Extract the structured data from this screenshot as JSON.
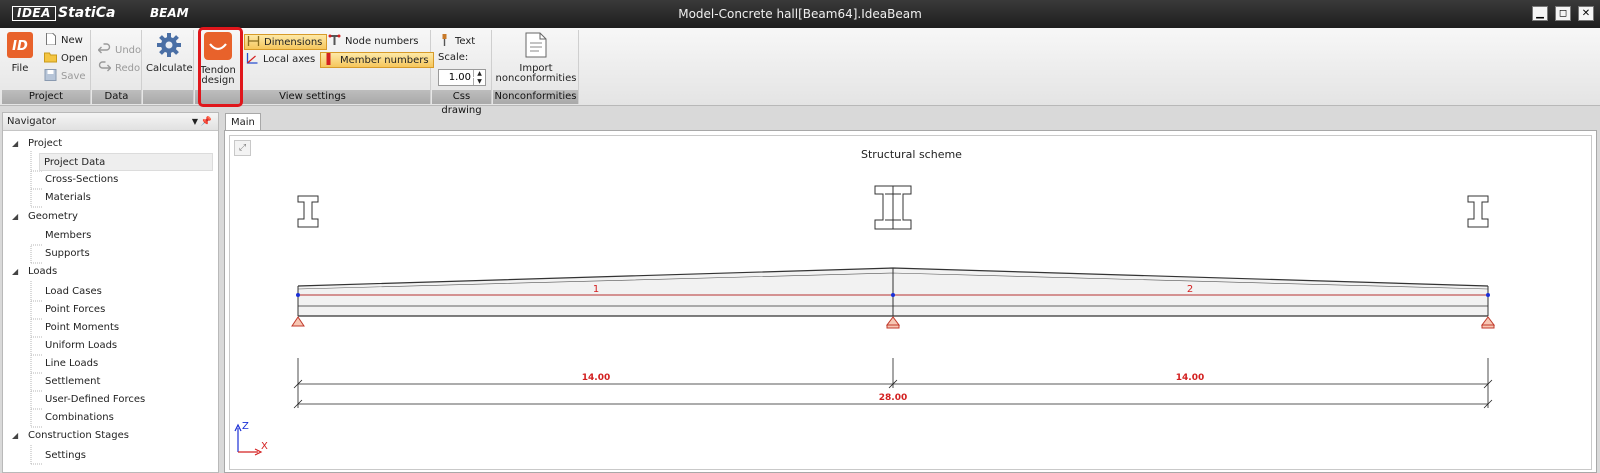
{
  "app": {
    "logo_box": "IDEA",
    "logo_text": "StatiCa",
    "product": "BEAM",
    "window_title": "Model-Concrete hall[Beam64].IdeaBeam",
    "window_buttons": {
      "minimize": "▁",
      "restore": "◻",
      "close": "✕"
    }
  },
  "ribbon": {
    "file_label": "File",
    "new_label": "New",
    "open_label": "Open",
    "save_label": "Save",
    "undo_label": "Undo",
    "redo_label": "Redo",
    "calculate_label": "Calculate",
    "tendon_line1": "Tendon",
    "tendon_line2": "design",
    "dimensions_label": "Dimensions",
    "local_axes_label": "Local axes",
    "node_numbers_label": "Node numbers",
    "member_numbers_label": "Member numbers",
    "text_label": "Text",
    "scale_label": "Scale:",
    "scale_value": "1.00",
    "import_line1": "Import",
    "import_line2": "nonconformities",
    "groups": {
      "project": "Project",
      "data": "Data",
      "view_settings": "View settings",
      "css_drawing": "Css drawing",
      "nonconformities": "Nonconformities"
    }
  },
  "navigator": {
    "title": "Navigator",
    "tree": [
      {
        "label": "Project",
        "children": [
          "Project Data",
          "Cross-Sections",
          "Materials"
        ]
      },
      {
        "label": "Geometry",
        "children": [
          "Members",
          "Supports"
        ]
      },
      {
        "label": "Loads",
        "children": [
          "Load Cases",
          "Point Forces",
          "Point Moments",
          "Uniform Loads",
          "Line Loads",
          "Settlement",
          "User-Defined Forces",
          "Combinations"
        ]
      },
      {
        "label": "Construction Stages",
        "children": [
          "Settings"
        ]
      }
    ]
  },
  "main": {
    "tab_label": "Main",
    "scheme_title": "Structural scheme",
    "member_labels": [
      "1",
      "2"
    ],
    "dimension_labels": [
      "14.00",
      "14.00",
      "28.00"
    ],
    "axis_labels": {
      "z": "Z",
      "x": "X"
    }
  },
  "colors": {
    "accent_orange": "#e8622b",
    "member_label_red": "#d32020",
    "node_blue": "#1a2fd6",
    "highlight_red": "#e0161b"
  }
}
